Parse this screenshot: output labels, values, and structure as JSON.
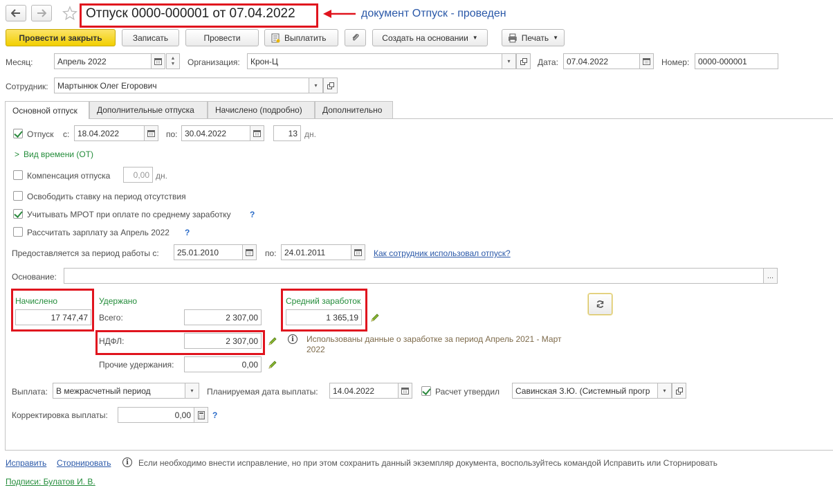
{
  "title": "Отпуск 0000-000001 от 07.04.2022",
  "annotation": "документ Отпуск - проведен",
  "toolbar": {
    "post_close": "Провести и закрыть",
    "save": "Записать",
    "post": "Провести",
    "pay": "Выплатить",
    "create_based": "Создать на основании",
    "print": "Печать"
  },
  "header": {
    "month_label": "Месяц:",
    "month_value": "Апрель 2022",
    "org_label": "Организация:",
    "org_value": "Крон-Ц",
    "date_label": "Дата:",
    "date_value": "07.04.2022",
    "number_label": "Номер:",
    "number_value": "0000-000001",
    "employee_label": "Сотрудник:",
    "employee_value": "Мартынюк Олег Егорович"
  },
  "tabs": [
    "Основной отпуск",
    "Дополнительные отпуска",
    "Начислено (подробно)",
    "Дополнительно"
  ],
  "vacation": {
    "label": "Отпуск",
    "from_label": "с:",
    "from_value": "18.04.2022",
    "to_label": "по:",
    "to_value": "30.04.2022",
    "days_value": "13",
    "days_unit": "дн.",
    "time_type": "Вид времени (ОТ)",
    "compensation_label": "Компенсация отпуска",
    "compensation_value": "0,00",
    "compensation_unit": "дн.",
    "free_rate": "Освободить ставку на период отсутствия",
    "mrot": "Учитывать МРОТ при оплате по среднему заработку",
    "calc_salary": "Рассчитать зарплату за Апрель 2022",
    "period_label": "Предоставляется за период работы с:",
    "period_from": "25.01.2010",
    "period_to_label": "по:",
    "period_to": "24.01.2011",
    "usage_link": "Как сотрудник использовал отпуск?",
    "basis_label": "Основание:",
    "basis_value": ""
  },
  "totals": {
    "accrued_label": "Начислено",
    "accrued_value": "17 747,47",
    "withheld_label": "Удержано",
    "total_label": "Всего:",
    "total_value": "2 307,00",
    "ndfl_label": "НДФЛ:",
    "ndfl_value": "2 307,00",
    "other_label": "Прочие удержания:",
    "other_value": "0,00",
    "avg_label": "Средний заработок",
    "avg_value": "1 365,19",
    "info_text_1": "Использованы данные о заработке за период Апрель 2021 - Март",
    "info_text_2": "2022"
  },
  "payment": {
    "label": "Выплата:",
    "value": "В межрасчетный период",
    "planned_label": "Планируемая дата выплаты:",
    "planned_value": "14.04.2022",
    "approved_label": "Расчет утвердил",
    "approved_value": "Савинская З.Ю. (Системный прогр",
    "correction_label": "Корректировка выплаты:",
    "correction_value": "0,00"
  },
  "footer": {
    "fix": "Исправить",
    "reverse": "Сторнировать",
    "note": "Если необходимо внести исправление, но при этом сохранить данный экземпляр документа, воспользуйтесь командой Исправить или Сторнировать",
    "signatures": "Подписи: Булатов И. В."
  },
  "colors": {
    "annotation_red": "#e0141e",
    "primary_yellow": "#f2cf00",
    "green_text": "#238c3a",
    "link_blue": "#2a58a8"
  }
}
